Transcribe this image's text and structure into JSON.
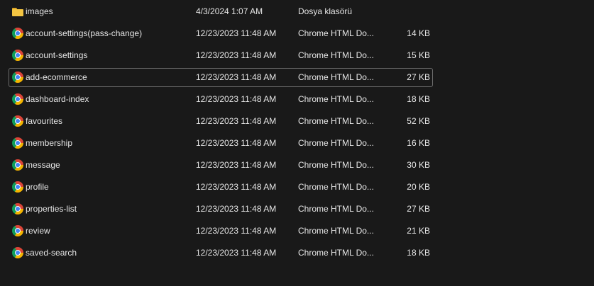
{
  "files": [
    {
      "name": "images",
      "date": "4/3/2024 1:07 AM",
      "type": "Dosya klasörü",
      "size": "",
      "icon": "folder-icon"
    },
    {
      "name": "account-settings(pass-change)",
      "date": "12/23/2023 11:48 AM",
      "type": "Chrome HTML Do...",
      "size": "14 KB",
      "icon": "chrome-icon"
    },
    {
      "name": "account-settings",
      "date": "12/23/2023 11:48 AM",
      "type": "Chrome HTML Do...",
      "size": "15 KB",
      "icon": "chrome-icon"
    },
    {
      "name": "add-ecommerce",
      "date": "12/23/2023 11:48 AM",
      "type": "Chrome HTML Do...",
      "size": "27 KB",
      "icon": "chrome-icon",
      "focused": true
    },
    {
      "name": "dashboard-index",
      "date": "12/23/2023 11:48 AM",
      "type": "Chrome HTML Do...",
      "size": "18 KB",
      "icon": "chrome-icon"
    },
    {
      "name": "favourites",
      "date": "12/23/2023 11:48 AM",
      "type": "Chrome HTML Do...",
      "size": "52 KB",
      "icon": "chrome-icon"
    },
    {
      "name": "membership",
      "date": "12/23/2023 11:48 AM",
      "type": "Chrome HTML Do...",
      "size": "16 KB",
      "icon": "chrome-icon"
    },
    {
      "name": "message",
      "date": "12/23/2023 11:48 AM",
      "type": "Chrome HTML Do...",
      "size": "30 KB",
      "icon": "chrome-icon"
    },
    {
      "name": "profile",
      "date": "12/23/2023 11:48 AM",
      "type": "Chrome HTML Do...",
      "size": "20 KB",
      "icon": "chrome-icon"
    },
    {
      "name": "properties-list",
      "date": "12/23/2023 11:48 AM",
      "type": "Chrome HTML Do...",
      "size": "27 KB",
      "icon": "chrome-icon"
    },
    {
      "name": "review",
      "date": "12/23/2023 11:48 AM",
      "type": "Chrome HTML Do...",
      "size": "21 KB",
      "icon": "chrome-icon"
    },
    {
      "name": "saved-search",
      "date": "12/23/2023 11:48 AM",
      "type": "Chrome HTML Do...",
      "size": "18 KB",
      "icon": "chrome-icon"
    }
  ],
  "colors": {
    "background": "#191919",
    "text": "#e6e6e6",
    "focus_border": "#6a6a6a",
    "folder": "#f4c542"
  }
}
